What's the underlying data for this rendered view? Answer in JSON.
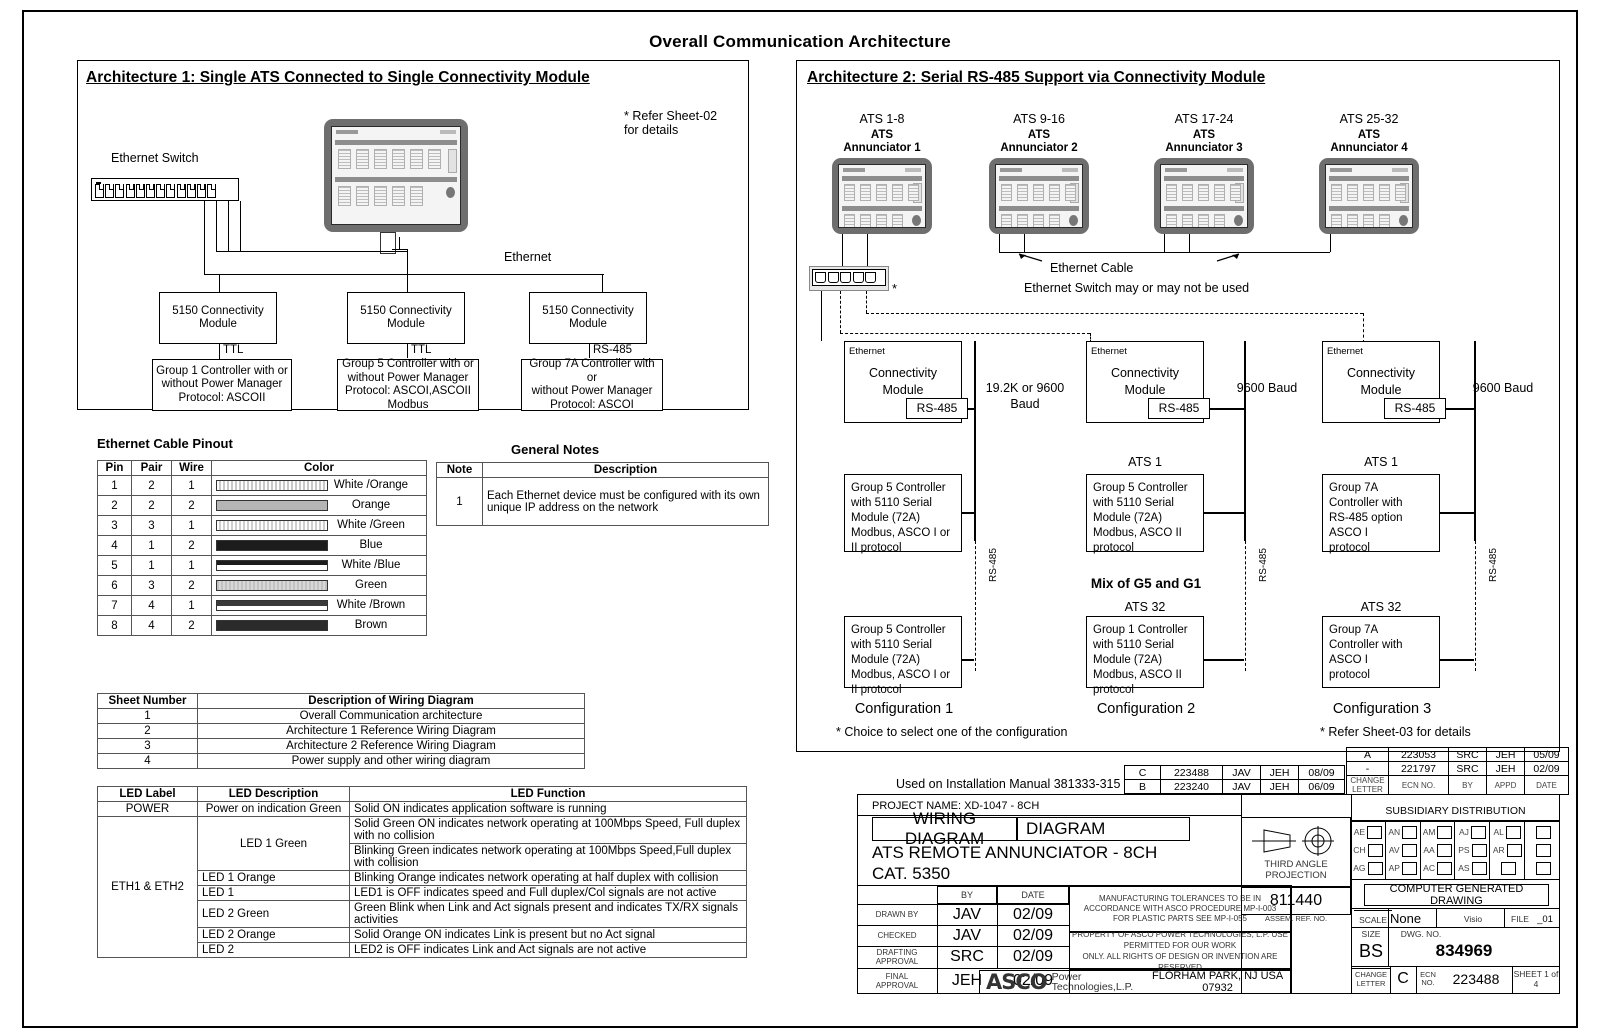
{
  "drawing": {
    "main_title": "Overall Communication Architecture"
  },
  "arch1": {
    "title": "Architecture 1: Single ATS Connected to Single Connectivity Module",
    "refer_note": "* Refer Sheet-02\nfor details",
    "ethernet_switch_label": "Ethernet Switch",
    "ethernet_label": "Ethernet",
    "modules": [
      {
        "name": "5150 Connectivity\nModule",
        "link": "TTL",
        "controller": "Group 1 Controller with or\nwithout Power Manager\nProtocol: ASCOII"
      },
      {
        "name": "5150 Connectivity\nModule",
        "link": "TTL",
        "controller": "Group 5 Controller with or\nwithout Power Manager\nProtocol: ASCOI,ASCOII\nModbus"
      },
      {
        "name": "5150 Connectivity\nModule",
        "link": "RS-485",
        "controller": "Group 7A Controller with or\nwithout Power Manager\nProtocol: ASCOI"
      }
    ]
  },
  "arch2": {
    "title": "Architecture 2: Serial RS-485 Support via Connectivity Module",
    "annunciators": [
      {
        "range": "ATS 1-8",
        "name": "ATS\nAnnunciator 1"
      },
      {
        "range": "ATS 9-16",
        "name": "ATS\nAnnunciator 2"
      },
      {
        "range": "ATS 17-24",
        "name": "ATS\nAnnunciator 3"
      },
      {
        "range": "ATS 25-32",
        "name": "ATS\nAnnunciator 4"
      }
    ],
    "cable_label": "Ethernet Cable",
    "switch_note": "Ethernet Switch may or may not be used",
    "asterisk": "*",
    "columns": [
      {
        "ethernet_label": "Ethernet",
        "module": "Connectivity\nModule",
        "port": "RS-485",
        "baud": "19.2K or 9600\nBaud",
        "bus_label": "RS-485",
        "top_ats": "",
        "top_controller": "Group 5 Controller\nwith 5110 Serial\nModule (72A)\nModbus, ASCO I or\nII protocol",
        "bottom_ats": "",
        "bottom_controller": "Group 5 Controller\nwith 5110 Serial\nModule (72A)\nModbus, ASCO I or\nII protocol",
        "config": "Configuration 1"
      },
      {
        "ethernet_label": "Ethernet",
        "module": "Connectivity\nModule",
        "port": "RS-485",
        "baud": "9600  Baud",
        "bus_label": "RS-485",
        "top_ats": "ATS 1",
        "top_controller": "Group 5 Controller\nwith 5110 Serial\nModule (72A)\nModbus, ASCO II\nprotocol",
        "mix_label": "Mix of G5 and G1",
        "bottom_ats": "ATS 32",
        "bottom_controller": "Group 1 Controller\nwith 5110 Serial\nModule (72A)\nModbus, ASCO II\nprotocol",
        "config": "Configuration 2"
      },
      {
        "ethernet_label": "Ethernet",
        "module": "Connectivity\nModule",
        "port": "RS-485",
        "baud": "9600  Baud",
        "bus_label": "RS-485",
        "top_ats": "ATS 1",
        "top_controller": "Group 7A\nController with\nRS-485 option\nASCO I\nprotocol",
        "bottom_ats": "ATS 32",
        "bottom_controller": "Group 7A\nController with\nASCO I\nprotocol",
        "config": "Configuration 3"
      }
    ],
    "footnote_left": "* Choice to select one of the configuration",
    "footnote_right": "* Refer Sheet-03 for details"
  },
  "pinout": {
    "caption": "Ethernet Cable Pinout",
    "headers": [
      "Pin",
      "Pair",
      "Wire",
      "Color"
    ],
    "rows": [
      {
        "pin": "1",
        "pair": "2",
        "wire": "1",
        "color": "White /Orange",
        "swatch": "sw-wo"
      },
      {
        "pin": "2",
        "pair": "2",
        "wire": "2",
        "color": "Orange",
        "swatch": "sw-o"
      },
      {
        "pin": "3",
        "pair": "3",
        "wire": "1",
        "color": "White /Green",
        "swatch": "sw-wg"
      },
      {
        "pin": "4",
        "pair": "1",
        "wire": "2",
        "color": "Blue",
        "swatch": "sw-b"
      },
      {
        "pin": "5",
        "pair": "1",
        "wire": "1",
        "color": "White /Blue",
        "swatch": "sw-wb"
      },
      {
        "pin": "6",
        "pair": "3",
        "wire": "2",
        "color": "Green",
        "swatch": "sw-g"
      },
      {
        "pin": "7",
        "pair": "4",
        "wire": "1",
        "color": "White /Brown",
        "swatch": "sw-wbr"
      },
      {
        "pin": "8",
        "pair": "4",
        "wire": "2",
        "color": "Brown",
        "swatch": "sw-br"
      }
    ]
  },
  "general_notes": {
    "caption": "General Notes",
    "headers": [
      "Note",
      "Description"
    ],
    "rows": [
      {
        "note": "1",
        "description": "Each Ethernet device must be configured with its own unique IP address on the network"
      }
    ]
  },
  "sheet_table": {
    "headers": [
      "Sheet Number",
      "Description of Wiring Diagram"
    ],
    "rows": [
      {
        "number": "1",
        "description": "Overall Communication architecture"
      },
      {
        "number": "2",
        "description": "Architecture 1 Reference Wiring Diagram"
      },
      {
        "number": "3",
        "description": "Architecture 2 Reference Wiring Diagram"
      },
      {
        "number": "4",
        "description": "Power supply and other wiring diagram"
      }
    ]
  },
  "led_table": {
    "headers": [
      "LED Label",
      "LED Description",
      "LED Function"
    ],
    "rows": [
      {
        "label": "POWER",
        "desc": "Power on indication Green",
        "func": "Solid ON indicates application software is running"
      },
      {
        "label": "ETH1 & ETH2",
        "desc": "LED 1 Green",
        "func": "Solid Green ON indicates network operating at 100Mbps Speed, Full duplex with no collision"
      },
      {
        "label": "",
        "desc": "",
        "func": "Blinking Green  indicates network operating at  100Mbps Speed,Full duplex with  collision"
      },
      {
        "label": "",
        "desc": "LED 1 Orange",
        "func": "Blinking Orange indicates network operating at half duplex with collision"
      },
      {
        "label": "",
        "desc": "LED 1",
        "func": "LED1 is OFF indicates speed and Full duplex/Col signals are not active"
      },
      {
        "label": "",
        "desc": "LED 2 Green",
        "func": "Green Blink when Link and Act signals present and indicates TX/RX signals activities"
      },
      {
        "label": "",
        "desc": "LED 2 Orange",
        "func": "Solid Orange ON indicates Link is present but no Act signal"
      },
      {
        "label": "",
        "desc": "LED 2",
        "func": "LED2 is OFF indicates Link and Act signals are not active"
      }
    ]
  },
  "title_block": {
    "used_on": "Used on Installation Manual 381333-315",
    "project_name": "PROJECT NAME: XD-1047 - 8CH",
    "doc_type_1": "WIRING DIAGRAM",
    "doc_type_2": "DIAGRAM",
    "product": "ATS REMOTE ANNUNCIATOR - 8CH",
    "catalog": "CAT. 5350",
    "sign_headers": {
      "by": "BY",
      "date": "DATE"
    },
    "signatures": [
      {
        "role": "DRAWN BY",
        "by": "JAV",
        "date": "02/09"
      },
      {
        "role": "CHECKED",
        "by": "JAV",
        "date": "02/09"
      },
      {
        "role": "DRAFTING\nAPPROVAL",
        "by": "SRC",
        "date": "02/09"
      },
      {
        "role": "FINAL\nAPPROVAL",
        "by": "JEH",
        "date": "02/09"
      }
    ],
    "tolerance_note": "MANUFACTURING TOLERANCES TO BE IN\nACCORDANCE WITH ASCO PROCEDURE MP-I-003\nFOR PLASTIC PARTS SEE MP-I-055",
    "property_note": "PROPERTY OF ASCO POWER TECHNOLOGIES, L.P. USE PERMITTED FOR OUR WORK\nONLY. ALL RIGHTS OF DESIGN OR INVENTION ARE RESERVED",
    "company_name": "ASCO",
    "company_sub": "Power\nTechnologies,L.P.",
    "company_address": "FLORHAM PARK, NJ USA 07932",
    "projection_label": "THIRD ANGLE\nPROJECTION",
    "assem_ref_no": "811440",
    "assem_ref_label": "ASSEM. REF. NO.",
    "computer_generated": "COMPUTER GENERATED DRAWING",
    "scale_label": "SCALE",
    "scale_value": "None",
    "software": "Visio",
    "file_label": "FILE",
    "file_value": "_01",
    "size_label": "SIZE",
    "size_value": "BS",
    "dwg_no_label": "DWG. NO.",
    "dwg_no": "834969",
    "change_letter_label": "CHANGE\nLETTER",
    "change_letter": "C",
    "ecn_label": "ECN\nNO.",
    "ecn_no": "223488",
    "sheet_of": "SHEET 1 of 4",
    "subsidiary_distribution": "SUBSIDIARY DISTRIBUTION",
    "subsidiary_codes": [
      [
        "AE",
        "CH",
        "AG"
      ],
      [
        "AN",
        "AV",
        "AP"
      ],
      [
        "AM",
        "AA",
        "AC"
      ],
      [
        "AJ",
        "PS",
        "AS"
      ],
      [
        "AL",
        "AR",
        ""
      ],
      [
        "",
        "",
        ""
      ]
    ],
    "revisions": {
      "headers": [
        "CHANGE\nLETTER",
        "ECN NO.",
        "BY",
        "APPD",
        "DATE"
      ],
      "rows": [
        {
          "letter": "C",
          "ecn": "223488",
          "by": "JAV",
          "appd": "JEH",
          "date": "08/09"
        },
        {
          "letter": "B",
          "ecn": "223240",
          "by": "JAV",
          "appd": "JEH",
          "date": "06/09"
        },
        {
          "letter": "A",
          "ecn": "223053",
          "by": "SRC",
          "appd": "JEH",
          "date": "05/09"
        },
        {
          "letter": "-",
          "ecn": "221797",
          "by": "SRC",
          "appd": "JEH",
          "date": "02/09"
        }
      ]
    }
  }
}
